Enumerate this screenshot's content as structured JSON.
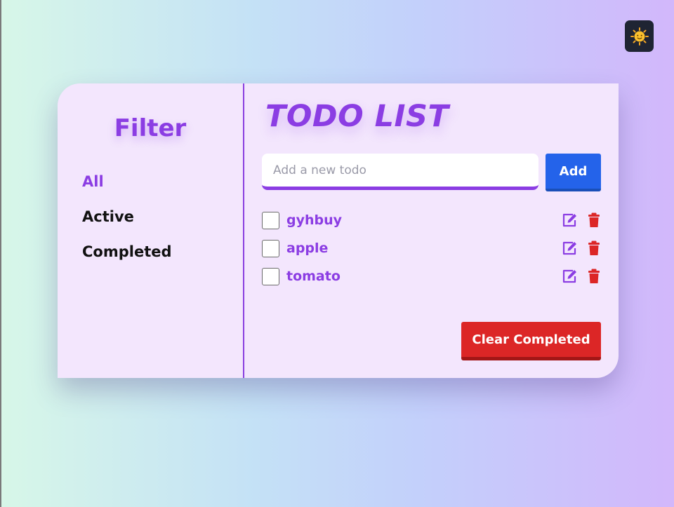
{
  "theme_toggle": {
    "icon": "sun-face-icon",
    "glyph": "🌞"
  },
  "sidebar": {
    "title": "Filter",
    "filters": [
      {
        "label": "All",
        "active": true
      },
      {
        "label": "Active",
        "active": false
      },
      {
        "label": "Completed",
        "active": false
      }
    ]
  },
  "main": {
    "title": "TODO LIST",
    "input_placeholder": "Add a new todo",
    "input_value": "",
    "add_label": "Add",
    "todos": [
      {
        "text": "gyhbuy",
        "completed": false
      },
      {
        "text": "apple",
        "completed": false
      },
      {
        "text": "tomato",
        "completed": false
      }
    ],
    "clear_label": "Clear Completed"
  },
  "colors": {
    "accent": "#8b3de3",
    "add_button": "#2463ea",
    "clear_button": "#dc2626",
    "card_background": "#f3e6fd"
  }
}
